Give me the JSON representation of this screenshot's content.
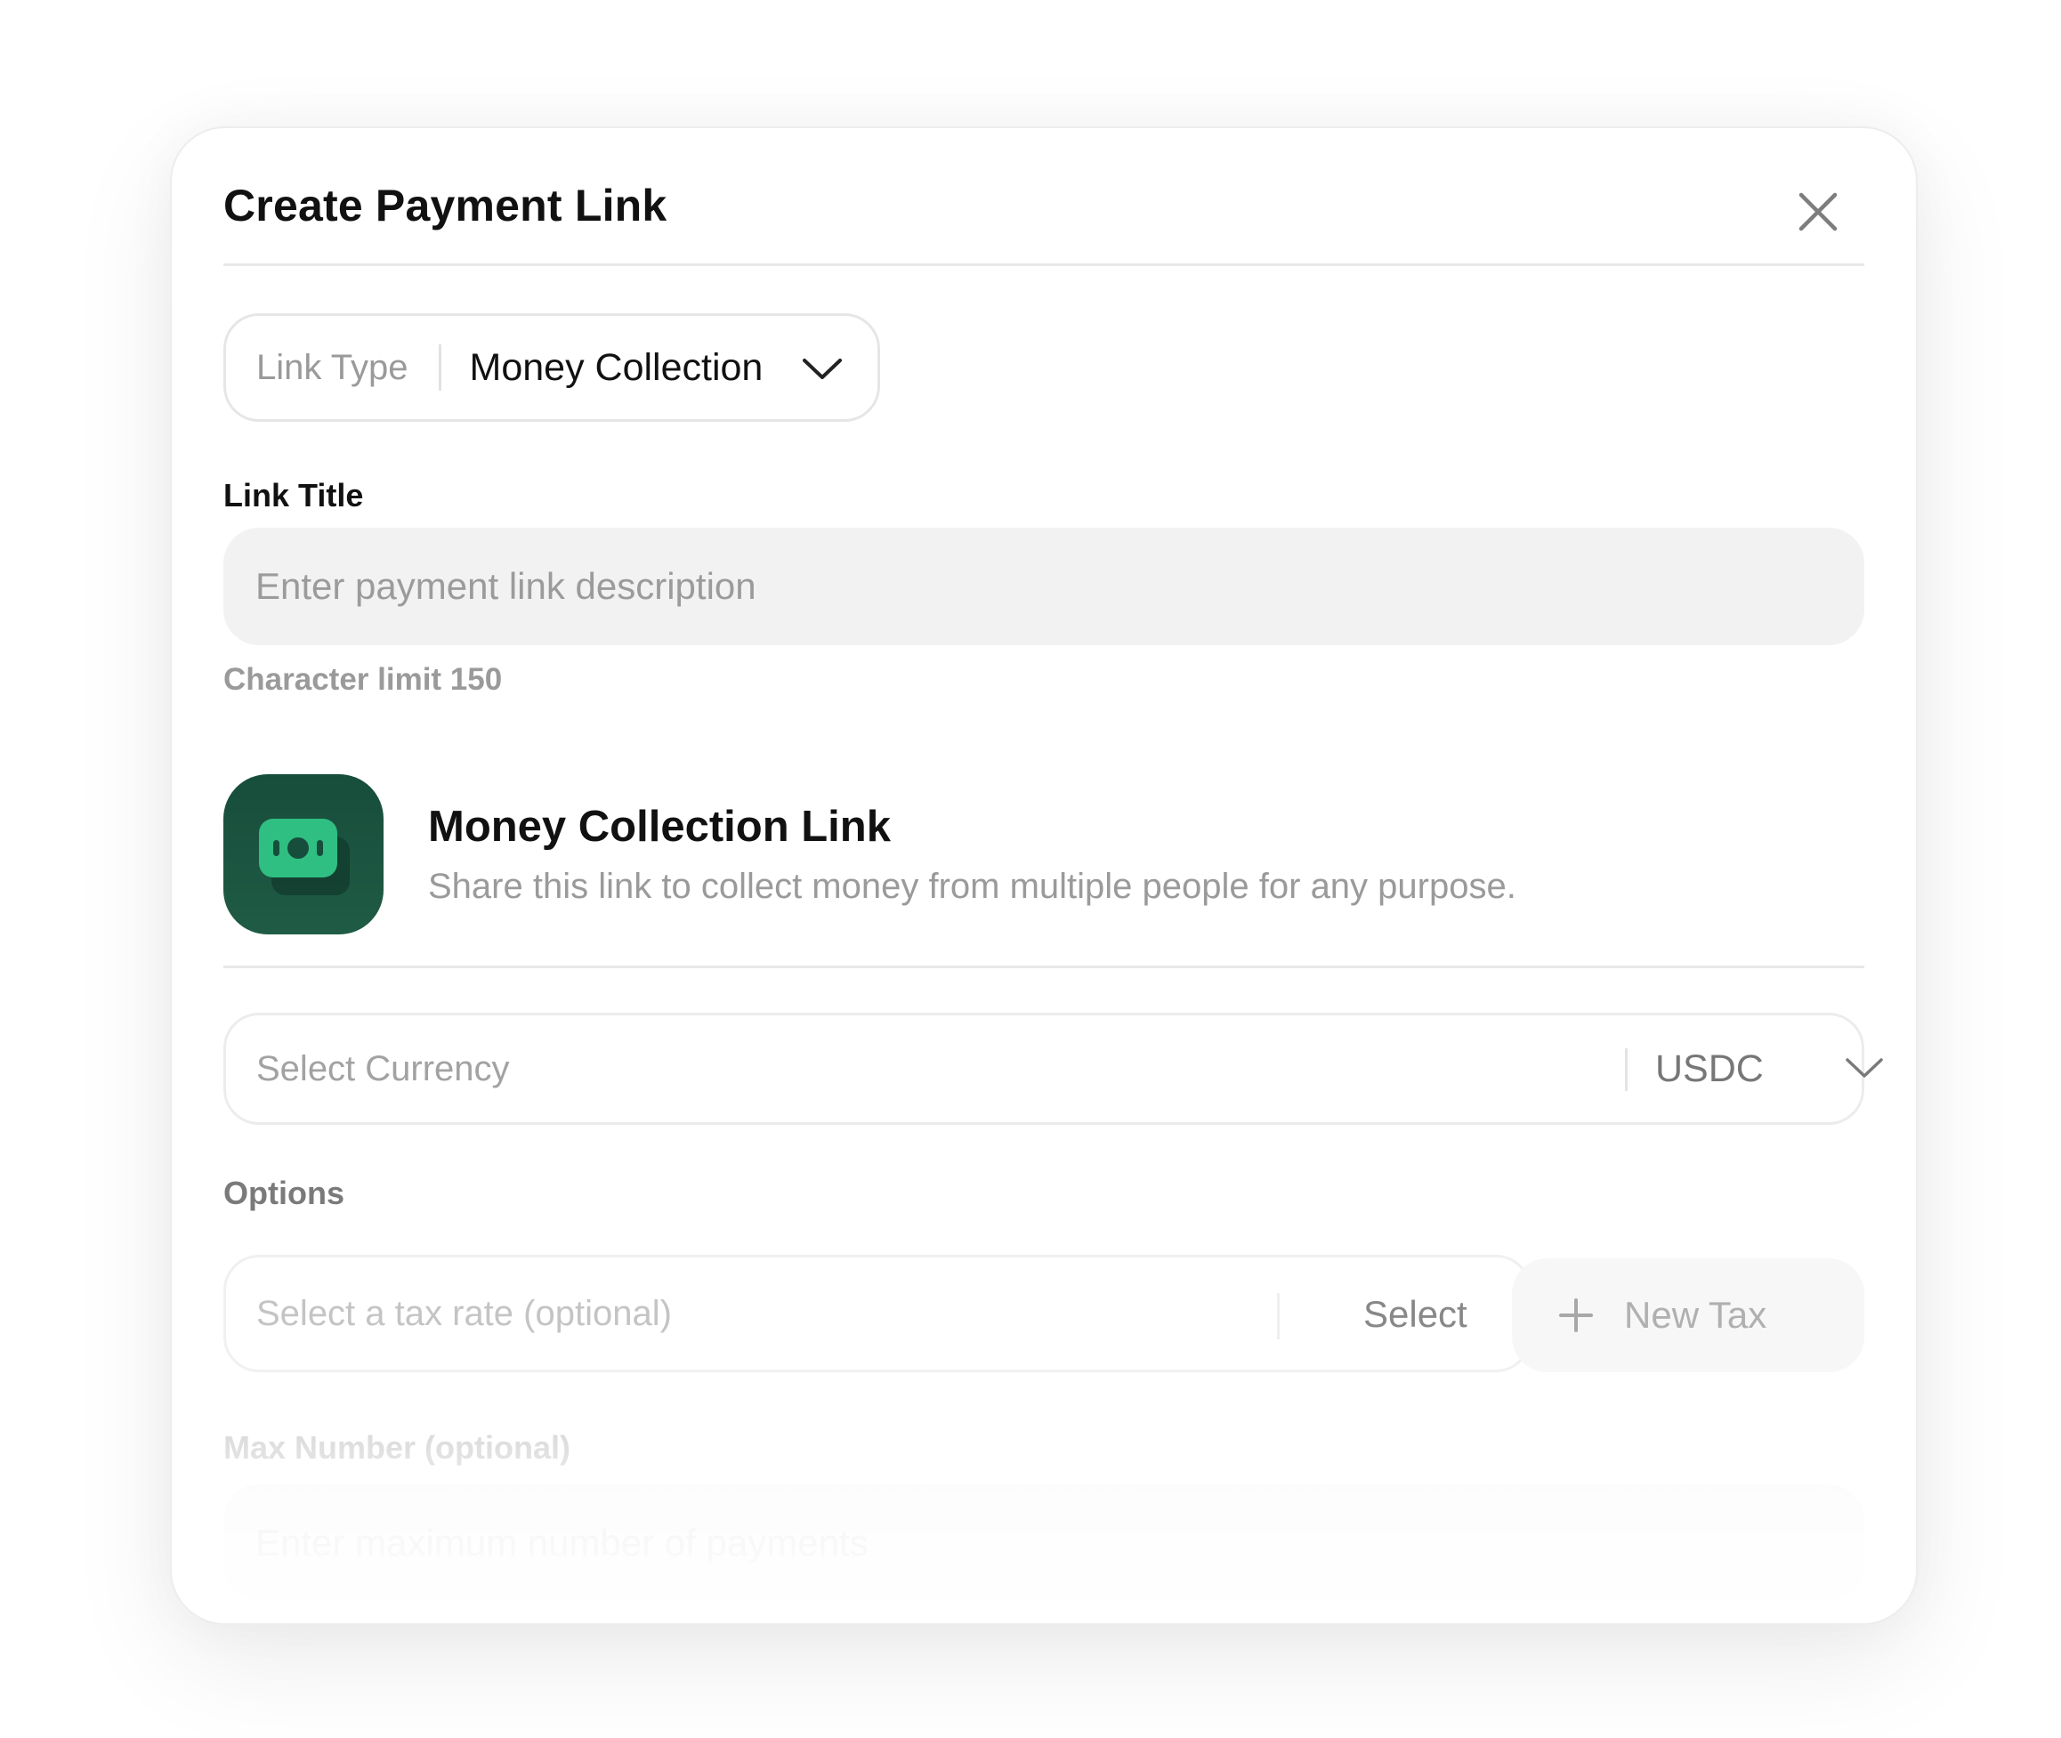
{
  "modal": {
    "title": "Create Payment Link",
    "close_icon": "close-icon"
  },
  "link_type": {
    "label": "Link Type",
    "value": "Money Collection",
    "icon": "chevron-down-icon"
  },
  "link_title": {
    "label": "Link Title",
    "placeholder": "Enter payment link description",
    "hint": "Character limit 150"
  },
  "info": {
    "icon": "money-bill-icon",
    "title": "Money Collection Link",
    "description": "Share this link to collect money from multiple people for any purpose."
  },
  "currency": {
    "placeholder": "Select Currency",
    "value": "USDC",
    "icon": "chevron-down-icon"
  },
  "options": {
    "label": "Options",
    "tax_placeholder": "Select a tax rate (optional)",
    "tax_select": "Select",
    "new_tax": "New Tax",
    "new_tax_icon": "plus-icon"
  },
  "max_number": {
    "label": "Max Number (optional)",
    "placeholder": "Enter maximum number of payments"
  },
  "colors": {
    "icon_bg": "#1b5440",
    "icon_accent": "#2fbf82",
    "text_primary": "#111111",
    "text_muted": "#9a9a9a"
  }
}
